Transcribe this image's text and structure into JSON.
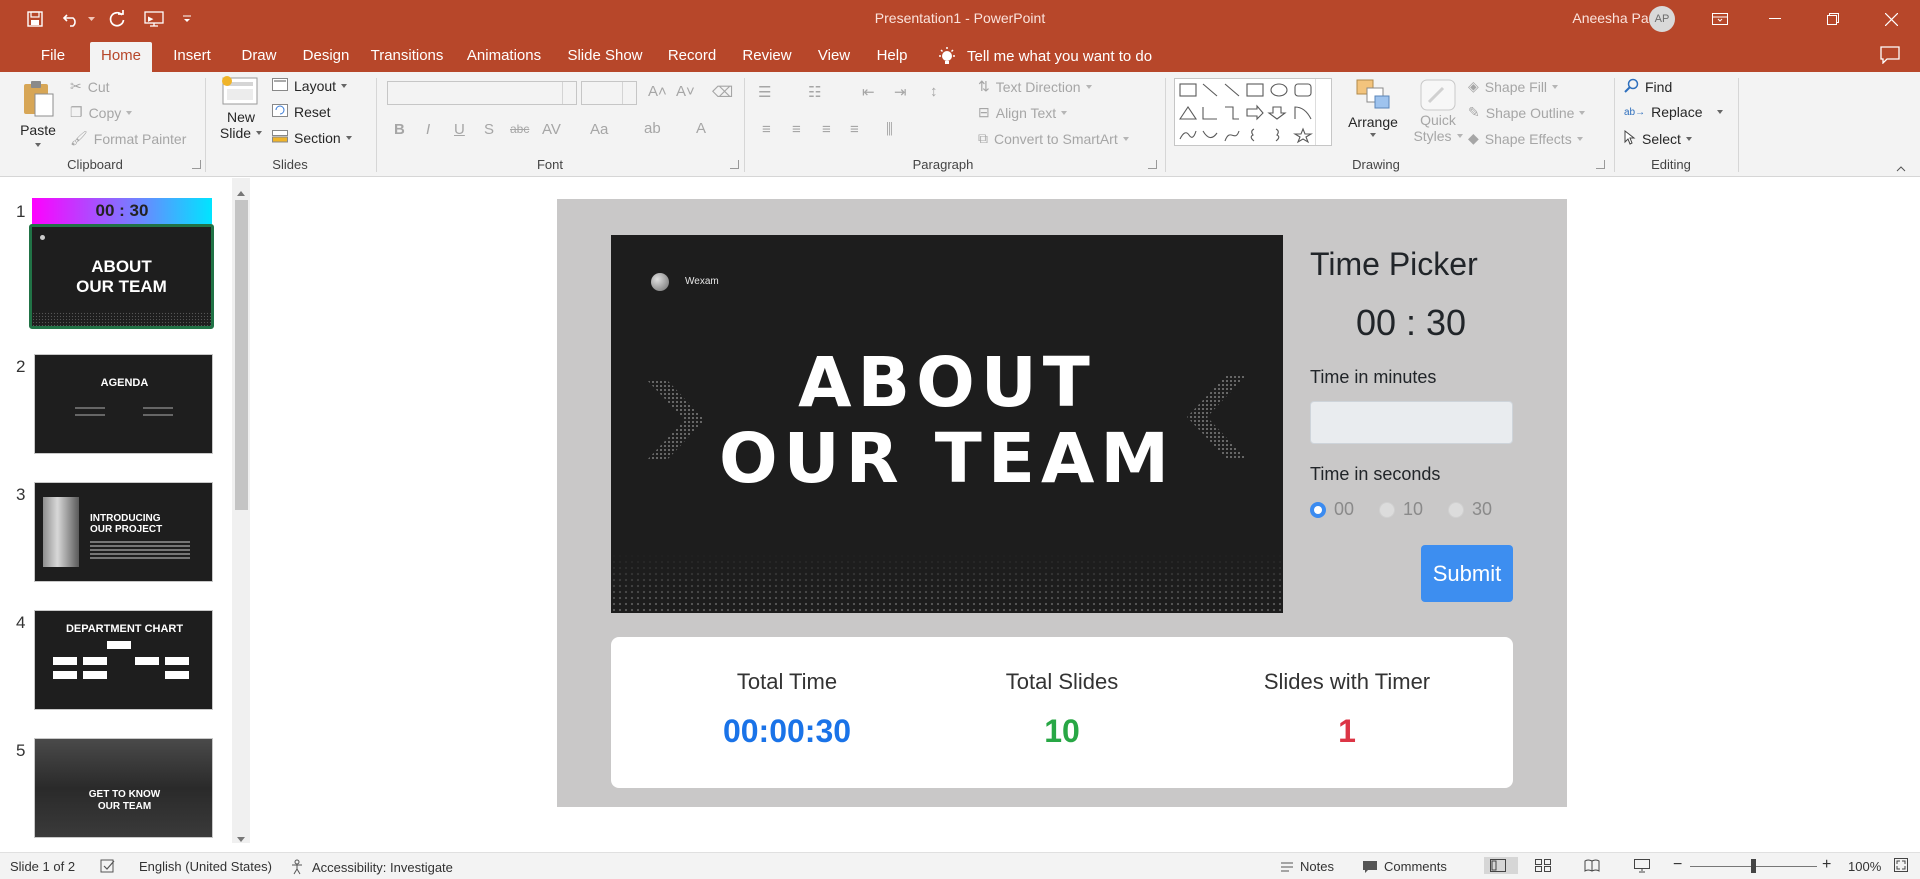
{
  "window": {
    "title": "Presentation1  -  PowerPoint",
    "user_name": "Aneesha Panda",
    "user_initials": "AP",
    "accent_color": "#b7472a"
  },
  "quick_access": [
    "save-icon",
    "undo-icon",
    "redo-icon",
    "present-icon",
    "customize-icon"
  ],
  "menu": {
    "tabs": [
      "File",
      "Home",
      "Insert",
      "Draw",
      "Design",
      "Transitions",
      "Animations",
      "Slide Show",
      "Record",
      "Review",
      "View",
      "Help"
    ],
    "active_tab": "Home",
    "tell_me": "Tell me what you want to do"
  },
  "ribbon": {
    "clipboard": {
      "label": "Clipboard",
      "paste": "Paste",
      "cut": "Cut",
      "copy": "Copy",
      "format_painter": "Format Painter"
    },
    "slides": {
      "label": "Slides",
      "new_slide_1": "New",
      "new_slide_2": "Slide",
      "layout": "Layout",
      "reset": "Reset",
      "section": "Section"
    },
    "font": {
      "label": "Font"
    },
    "paragraph": {
      "label": "Paragraph",
      "text_direction": "Text Direction",
      "align_text": "Align Text",
      "convert_smartart": "Convert to SmartArt"
    },
    "drawing": {
      "label": "Drawing",
      "arrange": "Arrange",
      "quick_styles_1": "Quick",
      "quick_styles_2": "Styles",
      "shape_fill": "Shape Fill",
      "shape_outline": "Shape Outline",
      "shape_effects": "Shape Effects"
    },
    "editing": {
      "label": "Editing",
      "find": "Find",
      "replace": "Replace",
      "select": "Select"
    }
  },
  "thumbnails": {
    "timer_badge": "00 : 30",
    "slides": [
      {
        "number": "1",
        "title_1": "ABOUT",
        "title_2": "OUR TEAM"
      },
      {
        "number": "2",
        "title": "AGENDA"
      },
      {
        "number": "3",
        "title_1": "INTRODUCING",
        "title_2": "OUR PROJECT"
      },
      {
        "number": "4",
        "title": "DEPARTMENT CHART"
      },
      {
        "number": "5",
        "title_1": "GET TO KNOW",
        "title_2": "OUR TEAM"
      }
    ]
  },
  "main_slide": {
    "brand": "Wexam",
    "title_line_1": "ABOUT",
    "title_line_2": "OUR TEAM"
  },
  "time_picker": {
    "title": "Time Picker",
    "display": "00 : 30",
    "minutes_label": "Time in minutes",
    "minutes_value": "",
    "seconds_label": "Time in seconds",
    "seconds_options": [
      "00",
      "10",
      "30"
    ],
    "seconds_selected": "00",
    "submit_label": "Submit"
  },
  "stats": {
    "total_time_label": "Total Time",
    "total_time_value": "00:00:30",
    "total_slides_label": "Total Slides",
    "total_slides_value": "10",
    "slides_with_timer_label": "Slides with Timer",
    "slides_with_timer_value": "1",
    "colors": {
      "time": "#1a73e8",
      "slides": "#28a745",
      "timer": "#dc3545"
    }
  },
  "statusbar": {
    "slide_position": "Slide 1 of 2",
    "language": "English (United States)",
    "accessibility": "Accessibility: Investigate",
    "notes": "Notes",
    "comments": "Comments",
    "zoom": "100%",
    "zoom_fraction": 0.5
  }
}
